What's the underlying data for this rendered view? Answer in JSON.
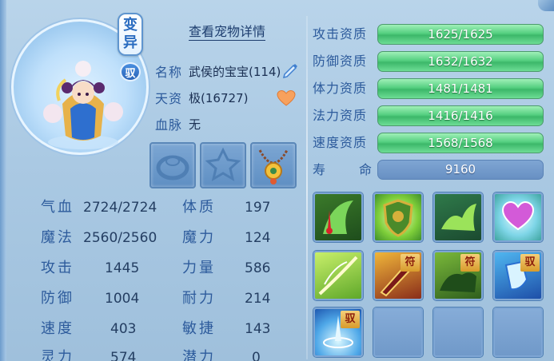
{
  "badges": {
    "mutant": [
      "变",
      "异"
    ],
    "ride": "驭"
  },
  "header": {
    "view_details": "查看宠物详情"
  },
  "info": {
    "name_label": "名称",
    "name_value": "武侯的宝宝(114)",
    "aptitude_label": "天资",
    "aptitude_value": "极(16727)",
    "bloodline_label": "血脉",
    "bloodline_value": "无"
  },
  "equipment": [
    "ring-slot",
    "amulet-slot",
    "necklace-slot"
  ],
  "attributes": {
    "left": [
      {
        "label": "气血",
        "value": "2724/2724"
      },
      {
        "label": "魔法",
        "value": "2560/2560"
      },
      {
        "label": "攻击",
        "value": "1445"
      },
      {
        "label": "防御",
        "value": "1004"
      },
      {
        "label": "速度",
        "value": "403"
      },
      {
        "label": "灵力",
        "value": "574"
      }
    ],
    "right": [
      {
        "label": "体质",
        "value": "197"
      },
      {
        "label": "魔力",
        "value": "124"
      },
      {
        "label": "力量",
        "value": "586"
      },
      {
        "label": "耐力",
        "value": "214"
      },
      {
        "label": "敏捷",
        "value": "143"
      },
      {
        "label": "潜力",
        "value": "0"
      }
    ]
  },
  "aptitudes": [
    {
      "label": "攻击资质",
      "value": "1625/1625",
      "fill": 1.0
    },
    {
      "label": "防御资质",
      "value": "1632/1632",
      "fill": 1.0
    },
    {
      "label": "体力资质",
      "value": "1481/1481",
      "fill": 1.0
    },
    {
      "label": "法力资质",
      "value": "1416/1416",
      "fill": 1.0
    },
    {
      "label": "速度资质",
      "value": "1568/1568",
      "fill": 1.0
    }
  ],
  "life": {
    "label_a": "寿",
    "label_b": "命",
    "value": "9160"
  },
  "skills": [
    {
      "name": "blood-drain-skill-icon",
      "tag": ""
    },
    {
      "name": "shield-emblem-skill-icon",
      "tag": ""
    },
    {
      "name": "beast-spirit-skill-icon",
      "tag": ""
    },
    {
      "name": "heart-skill-icon",
      "tag": ""
    },
    {
      "name": "leaf-skill-icon",
      "tag": ""
    },
    {
      "name": "strike-skill-icon",
      "tag": "符"
    },
    {
      "name": "beast-charge-skill-icon",
      "tag": "符"
    },
    {
      "name": "water-shield-skill-icon",
      "tag": "驭"
    },
    {
      "name": "whirlpool-skill-icon",
      "tag": "驭"
    },
    {
      "name": "empty-skill-slot",
      "tag": ""
    },
    {
      "name": "empty-skill-slot",
      "tag": ""
    },
    {
      "name": "empty-skill-slot",
      "tag": ""
    }
  ],
  "colors": {
    "bar_green": "#54cf80",
    "bar_blue": "#6890c3",
    "label_blue": "#2d5b9c"
  }
}
